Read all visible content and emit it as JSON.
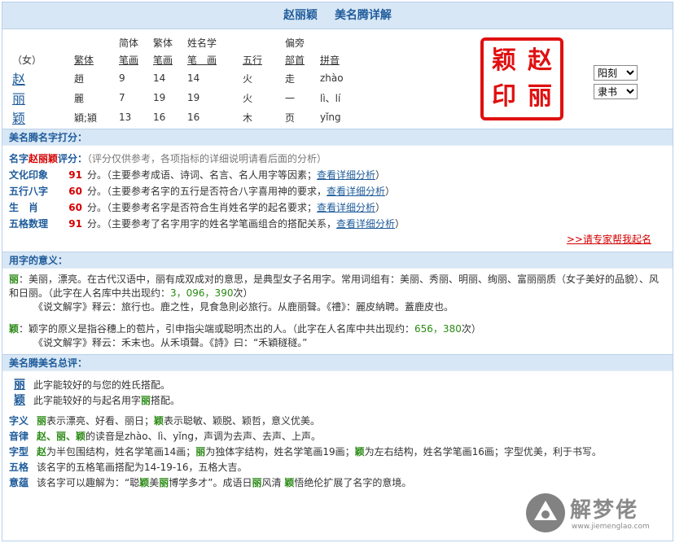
{
  "header": {
    "name": "赵丽颖",
    "subtitle": "美名腾详解"
  },
  "grid": {
    "headers_top": [
      "",
      "",
      "简体",
      "繁体",
      "姓名学",
      "",
      "偏旁",
      ""
    ],
    "headers": [
      "（女）",
      "繁体",
      "笔画",
      "笔画",
      "笔　画",
      "五行",
      "部首",
      "拼音"
    ],
    "rows": [
      {
        "char": "赵",
        "trad": "趙",
        "simple": "9",
        "tradStroke": "14",
        "nameStroke": "14",
        "wuxing": "火",
        "radical": "走",
        "pinyin": "zhào"
      },
      {
        "char": "丽",
        "trad": "麗",
        "simple": "7",
        "tradStroke": "19",
        "nameStroke": "19",
        "wuxing": "火",
        "radical": "一",
        "pinyin": "lì、lí"
      },
      {
        "char": "颖",
        "trad": "穎;潁",
        "simple": "13",
        "tradStroke": "16",
        "nameStroke": "16",
        "wuxing": "木",
        "radical": "页",
        "pinyin": "yǐng"
      }
    ]
  },
  "seal": {
    "chars": [
      "赵",
      "丽",
      "颖",
      "印"
    ],
    "color": "#e01010"
  },
  "selects": {
    "style": "阳刻",
    "font": "隶书"
  },
  "score": {
    "title": "美名腾名字打分：",
    "intro_prefix": "名字",
    "intro_name": "赵丽颖",
    "intro_suffix": "评分：",
    "intro_note": "（评分仅供参考，各项指标的详细说明请看后面的分析）",
    "unit": "分。",
    "items": [
      {
        "label": "文化印象",
        "value": "91",
        "desc": "（主要参考成语、诗词、名言、名人用字等因素；",
        "link": "查看详细分析",
        "end": "）"
      },
      {
        "label": "五行八字",
        "value": "60",
        "desc": "（主要参考名字的五行是否符合八字喜用神的要求，",
        "link": "查看详细分析",
        "end": "）"
      },
      {
        "label": "生　肖",
        "value": "60",
        "desc": "（主要参考名字是否符合生肖姓名学的起名要求；",
        "link": "查看详细分析",
        "end": "）"
      },
      {
        "label": "五格数理",
        "value": "91",
        "desc": "（主要参考了名字用字的姓名学笔画组合的搭配关系，",
        "link": "查看详细分析",
        "end": "）"
      }
    ],
    "expert": ">>请专家帮我起名"
  },
  "meaning": {
    "title": "用字的意义：",
    "li": {
      "char": "丽",
      "text": "：美丽，漂亮。在古代汉语中，丽有成双成对的意思，是典型女子名用字。常用词组有：美丽、秀丽、明丽、绚丽、富丽丽质（女子美好的品貌）、风和日丽。（此字在人名库中共出现约：",
      "count": "3，096，390",
      "tail": "次）",
      "shuowen": "《说文解字》释云：旅行也。鹿之性，見食急則必旅行。从鹿丽聲。《禮》：麗皮納聘。蓋鹿皮也。"
    },
    "ying": {
      "char": "颖",
      "text": "：颖字的原义是指谷穗上的苞片，引申指尖端或聪明杰出的人。（此字在人名库中共出现约：",
      "count": "656，380",
      "tail": "次）",
      "shuowen": "《说文解字》释云：禾末也。从禾頃聲。《詩》曰：“禾穎穟穟。”"
    }
  },
  "summary": {
    "title": "美名腾美名总评：",
    "match1": {
      "char": "丽",
      "text": "此字能较好的与您的姓氏搭配。"
    },
    "match2": {
      "char": "颖",
      "text_a": "此字能较好的与起名用字",
      "hl": "丽",
      "text_b": "搭配。"
    },
    "rows": {
      "meaning_label": "字义",
      "meaning_c1": "丽",
      "meaning_t1": "表示漂亮、好看、丽日；",
      "meaning_c2": "颖",
      "meaning_t2": "表示聪敏、颖脱、颖哲，意义优美。",
      "sound_label": "音律",
      "sound_chars": "赵、丽、颖",
      "sound_text": "的读音是zhào、lì、yǐng，声调为去声、去声、上声。",
      "shape_label": "字型",
      "shape_c1": "赵",
      "shape_t1": "为半包围结构，姓名学笔画14画；",
      "shape_c2": "丽",
      "shape_t2": "为独体字结构，姓名学笔画19画；",
      "shape_c3": "颖",
      "shape_t3": "为左右结构，姓名学笔画16画；字型优美，利于书写。",
      "wuge_label": "五格",
      "wuge_text": "该名字的五格笔画搭配为14-19-16，五格大吉。",
      "yiyun_label": "意蕴",
      "yiyun_a": "该名字可以趣解为：“聪",
      "yiyun_c1": "颖",
      "yiyun_b": "美",
      "yiyun_c2": "丽",
      "yiyun_c": "博学多才”。成语日",
      "yiyun_c3": "丽",
      "yiyun_d": "风清 ",
      "yiyun_c4": "颖",
      "yiyun_e": "悟绝伦扩展了名字的意境。"
    }
  },
  "watermark": {
    "text": "解梦佬",
    "url": "www.jiemenglao.com"
  }
}
